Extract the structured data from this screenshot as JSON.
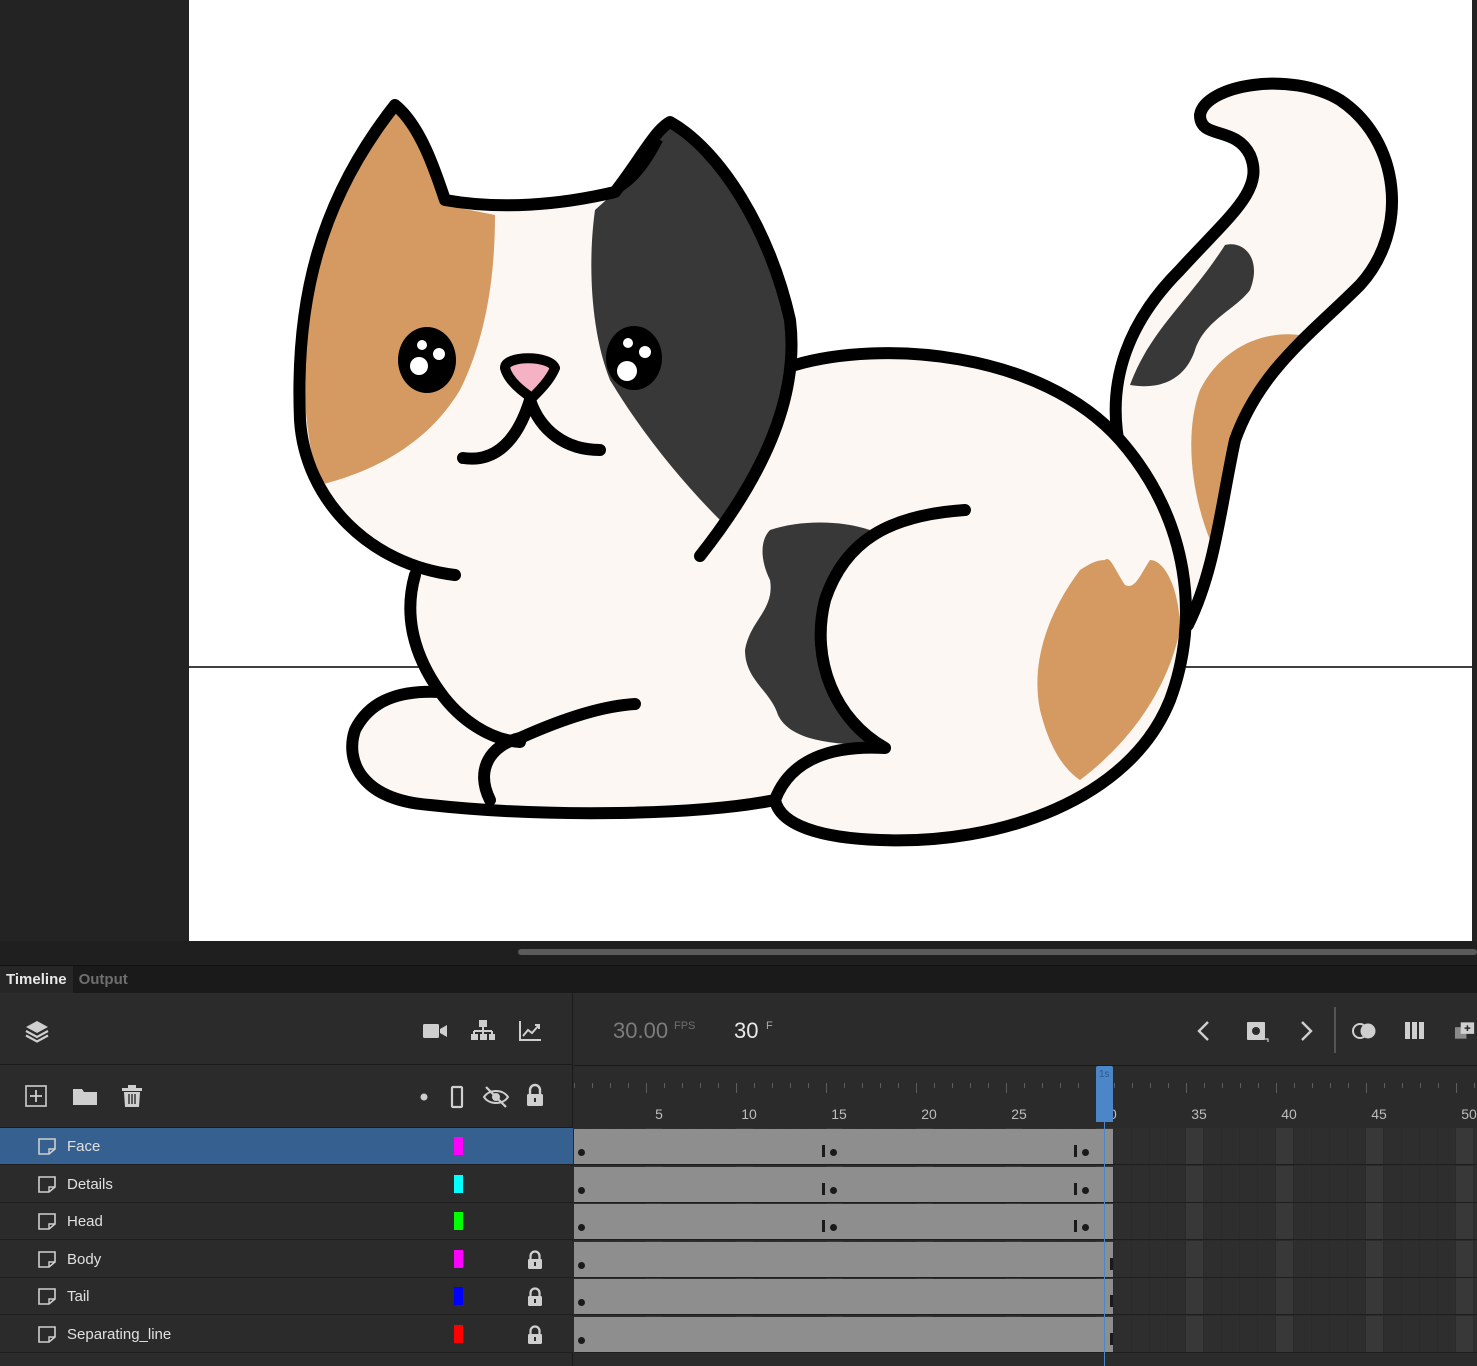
{
  "panel_tabs": [
    {
      "label": "Timeline",
      "active": true
    },
    {
      "label": "Output",
      "active": false
    }
  ],
  "timeline": {
    "fps": "30.00",
    "fps_unit": "FPS",
    "current_frame": "30",
    "frame_unit": "F",
    "ruler_labels": [
      "5",
      "10",
      "15",
      "20",
      "25",
      "30",
      "35",
      "40",
      "45",
      "50"
    ],
    "playhead_label": "1s",
    "layers": [
      {
        "name": "Face",
        "color": "#ff00ff",
        "locked": false,
        "selected": true
      },
      {
        "name": "Details",
        "color": "#00ffff",
        "locked": false,
        "selected": false
      },
      {
        "name": "Head",
        "color": "#00ff00",
        "locked": false,
        "selected": false
      },
      {
        "name": "Body",
        "color": "#ff00ff",
        "locked": true,
        "selected": false
      },
      {
        "name": "Tail",
        "color": "#0000ff",
        "locked": true,
        "selected": false
      },
      {
        "name": "Separating_line",
        "color": "#ff0000",
        "locked": true,
        "selected": false
      }
    ]
  },
  "colors": {
    "accent": "#35608f",
    "playhead": "#4a86c8",
    "cat_orange": "#d49a62",
    "cat_black": "#383838",
    "cat_white": "#fcf7f2",
    "nose_pink": "#f4b2c4"
  },
  "icons": {
    "layers": "layers-icon",
    "camera": "camera-icon",
    "parenting": "hierarchy-icon",
    "graph": "graph-icon",
    "new_layer": "new-layer-icon",
    "new_folder": "folder-icon",
    "delete": "trash-icon",
    "highlight": "dot-icon",
    "outline": "outline-icon",
    "visibility": "eye-hidden-icon",
    "lock": "lock-icon",
    "prev_key": "chevron-left-icon",
    "insert_key": "insert-keyframe-icon",
    "next_key": "chevron-right-icon",
    "onion": "onion-skin-icon",
    "edit_multiple": "edit-multiple-icon",
    "layer_depth": "layer-depth-icon"
  }
}
